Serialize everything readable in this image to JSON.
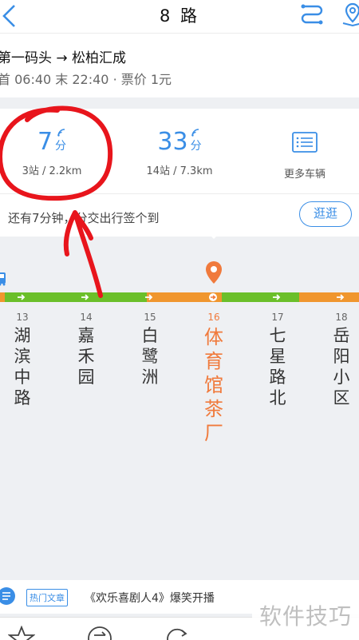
{
  "header": {
    "title": "8 路"
  },
  "route": {
    "direction": "第一码头 → 松柏汇成",
    "schedule": "首 06:40 末 22:40 · 票价 1元"
  },
  "arrivals": [
    {
      "minutes": "7",
      "unit": "分",
      "detail": "3站 / 2.2km"
    },
    {
      "minutes": "33",
      "unit": "分",
      "detail": "14站 / 7.3km"
    }
  ],
  "more_vehicles": "更多车辆",
  "notice": "还有7分钟，分交出行签个到",
  "stroll_button": "逛逛",
  "stations": [
    {
      "no": "13",
      "name": [
        "湖",
        "滨",
        "中",
        "路"
      ]
    },
    {
      "no": "14",
      "name": [
        "嘉",
        "禾",
        "园"
      ]
    },
    {
      "no": "15",
      "name": [
        "白",
        "鹭",
        "洲"
      ]
    },
    {
      "no": "16",
      "name": [
        "体",
        "育",
        "馆",
        "茶",
        "厂"
      ]
    },
    {
      "no": "17",
      "name": [
        "七",
        "星",
        "路",
        "北"
      ]
    },
    {
      "no": "18",
      "name": [
        "岳",
        "阳",
        "小",
        "区"
      ]
    }
  ],
  "article": {
    "tag": "热门文章",
    "headline": "《欢乐喜剧人4》爆笑开播"
  },
  "watermark": "软件技巧",
  "colors": {
    "accent": "#3a8ee6",
    "traffic_green": "#6bbf2a",
    "traffic_orange": "#f0962e",
    "current_station": "#f07a3c",
    "annotation": "#e8151c"
  },
  "icons": [
    "back-arrow-icon",
    "route-switch-icon",
    "map-pin-icon",
    "vehicle-list-icon",
    "bus-icon",
    "location-pin-icon",
    "article-icon",
    "star-icon",
    "refresh-icon"
  ]
}
